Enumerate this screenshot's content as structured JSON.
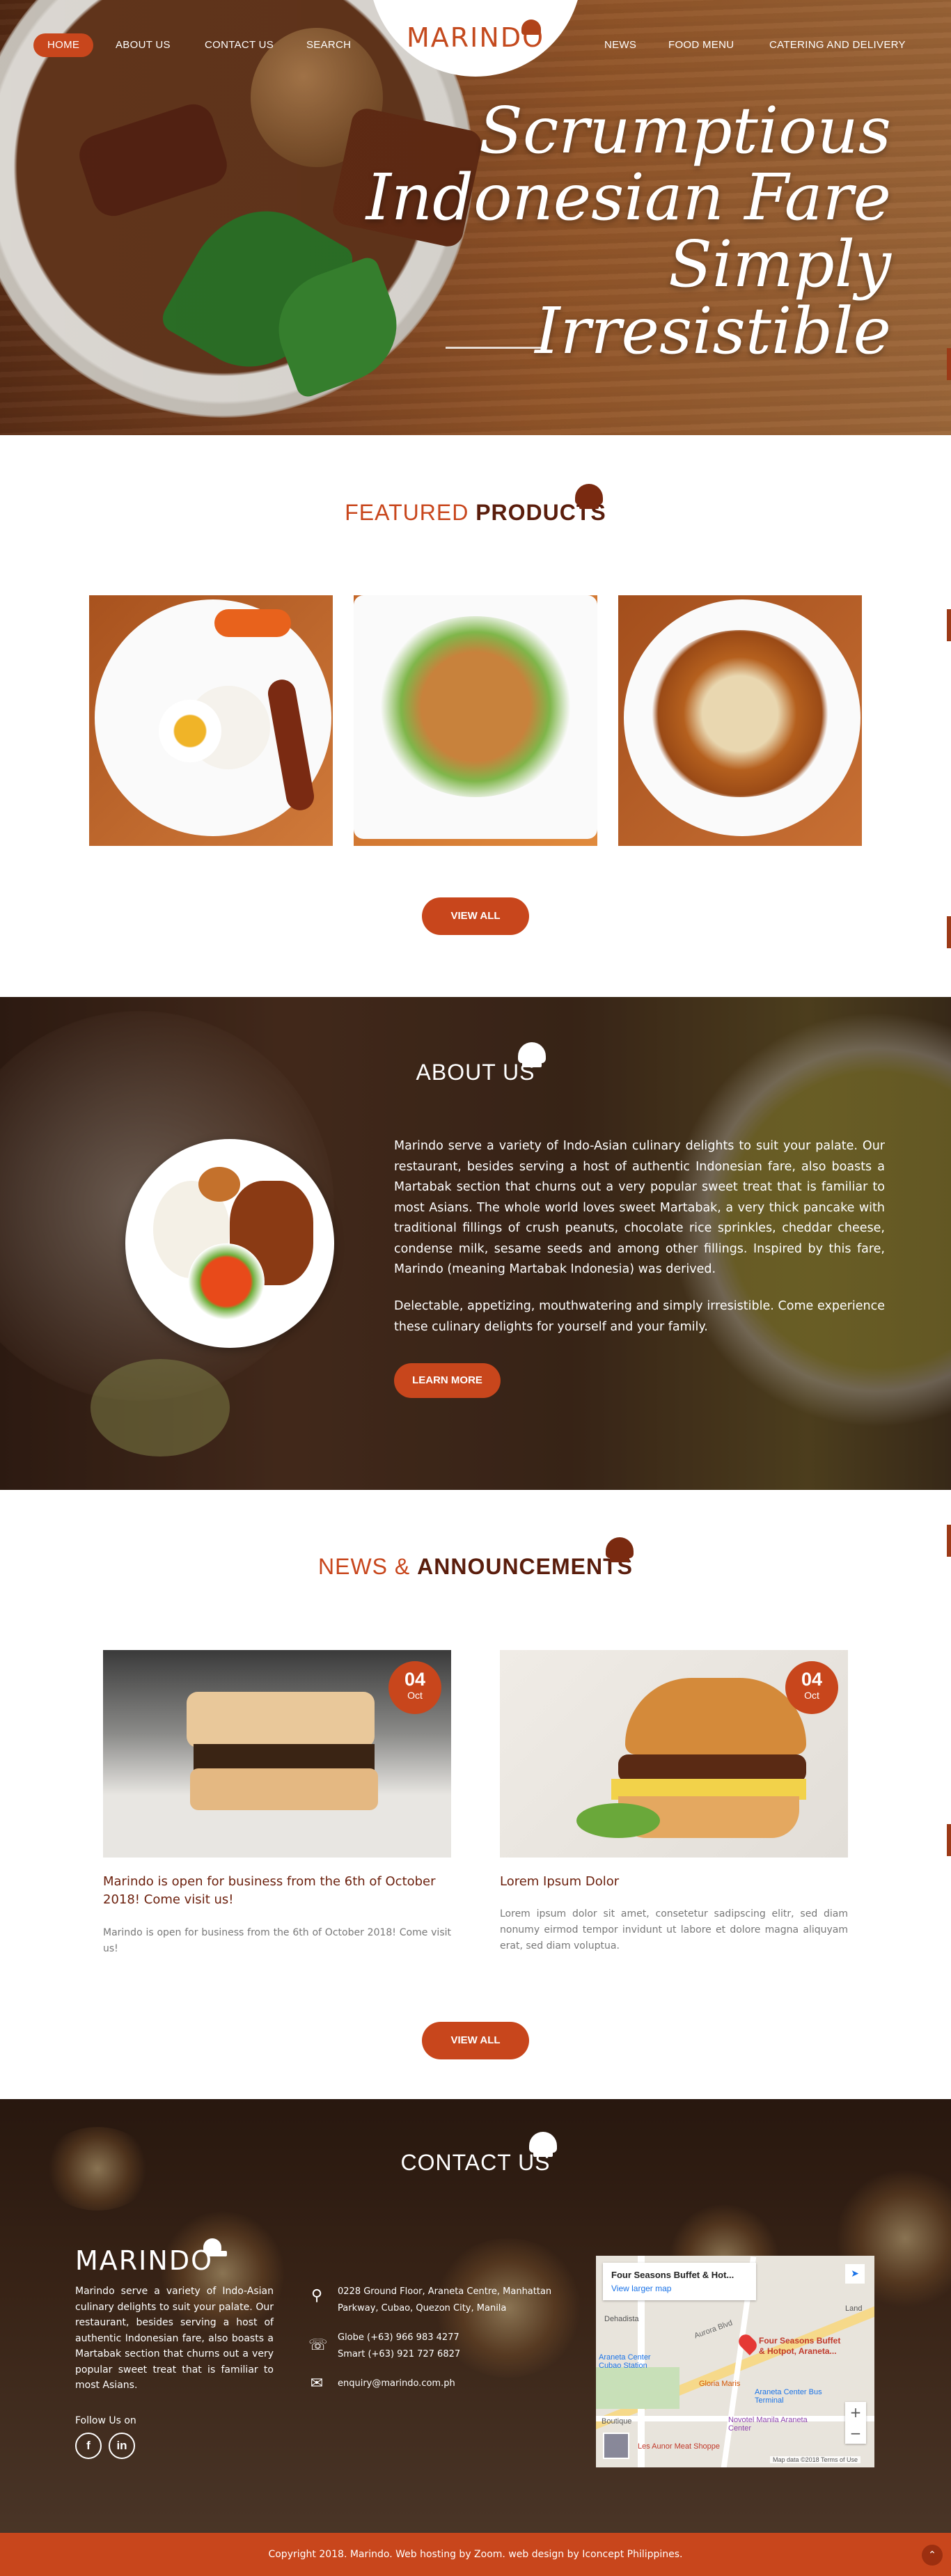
{
  "nav": {
    "left": [
      "HOME",
      "ABOUT US",
      "CONTACT US",
      "SEARCH"
    ],
    "right": [
      "NEWS",
      "FOOD MENU",
      "CATERING AND DELIVERY"
    ],
    "logo": "MARINDO"
  },
  "hero": {
    "line1": "Scrumptious",
    "line2": "Indonesian Fare",
    "line3": "Simply Irresistible"
  },
  "featured": {
    "title_a": "FEATURED",
    "title_b": "PRODUCTS",
    "button": "VIEW ALL"
  },
  "about": {
    "title": "ABOUT US",
    "p1": "Marindo serve a variety of Indo-Asian culinary delights to suit your palate. Our restaurant, besides serving a host of authentic Indonesian fare, also boasts a Martabak section that churns out a very popular sweet treat that is familiar to most Asians. The whole world loves sweet Martabak, a very thick pancake with traditional fillings of crush peanuts, chocolate rice sprinkles, cheddar cheese, condense milk, sesame seeds and among other fillings. Inspired by this fare, Marindo (meaning Martabak Indonesia) was derived.",
    "p2": "Delectable, appetizing, mouthwatering and simply irresistible. Come experience these culinary delights for yourself and your family.",
    "button": "LEARN MORE"
  },
  "news": {
    "title_a": "NEWS &",
    "title_b": "ANNOUNCEMENTS",
    "items": [
      {
        "day": "04",
        "month": "Oct",
        "title": "Marindo is open for business from the 6th of October 2018! Come visit us!",
        "body": "Marindo is open for business from the 6th of October 2018! Come visit us!"
      },
      {
        "day": "04",
        "month": "Oct",
        "title": "Lorem Ipsum Dolor",
        "body": "Lorem ipsum dolor sit amet, consetetur sadipscing elitr, sed diam nonumy eirmod tempor invidunt ut labore et dolore magna aliquyam erat, sed diam voluptua."
      }
    ],
    "button": "VIEW ALL"
  },
  "contact": {
    "title": "CONTACT US",
    "logo": "MARINDO",
    "about": "Marindo serve a variety of Indo-Asian culinary delights to suit your palate. Our restaurant, besides serving a host of authentic Indonesian fare, also boasts a Martabak section that churns out a very popular sweet treat that is familiar to most Asians.",
    "follow": "Follow Us on",
    "social": [
      "f",
      "in"
    ],
    "address_1": "0228 Ground Floor, Araneta Centre, Manhattan",
    "address_2": "Parkway, Cubao, Quezon City, Manila",
    "phone_1": "Globe (+63) 966 983 4277",
    "phone_2": "Smart (+63) 921 727 6827",
    "email": "enquiry@marindo.com.ph",
    "map": {
      "place": "Four Seasons Buffet & Hot...",
      "larger": "View larger map",
      "pin_label_1": "Four Seasons Buffet",
      "pin_label_2": "& Hotpot, Araneta...",
      "labels": [
        "Aurora Blvd",
        "Gloria Maris",
        "Araneta Center Bus Terminal",
        "Novotel Manila Araneta Center",
        "Les Aunor Meat Shoppe",
        "Dehadista",
        "Araneta Center Cubao Station",
        "Boutique",
        "Land"
      ],
      "attrib": "Map data ©2018  Terms of Use"
    }
  },
  "footer": {
    "text": "Copyright 2018. Marindo. Web hosting by Zoom. web design by Iconcept Philippines."
  },
  "colors": {
    "accent": "#c8461c",
    "dark_brown": "#5a1d0c"
  }
}
